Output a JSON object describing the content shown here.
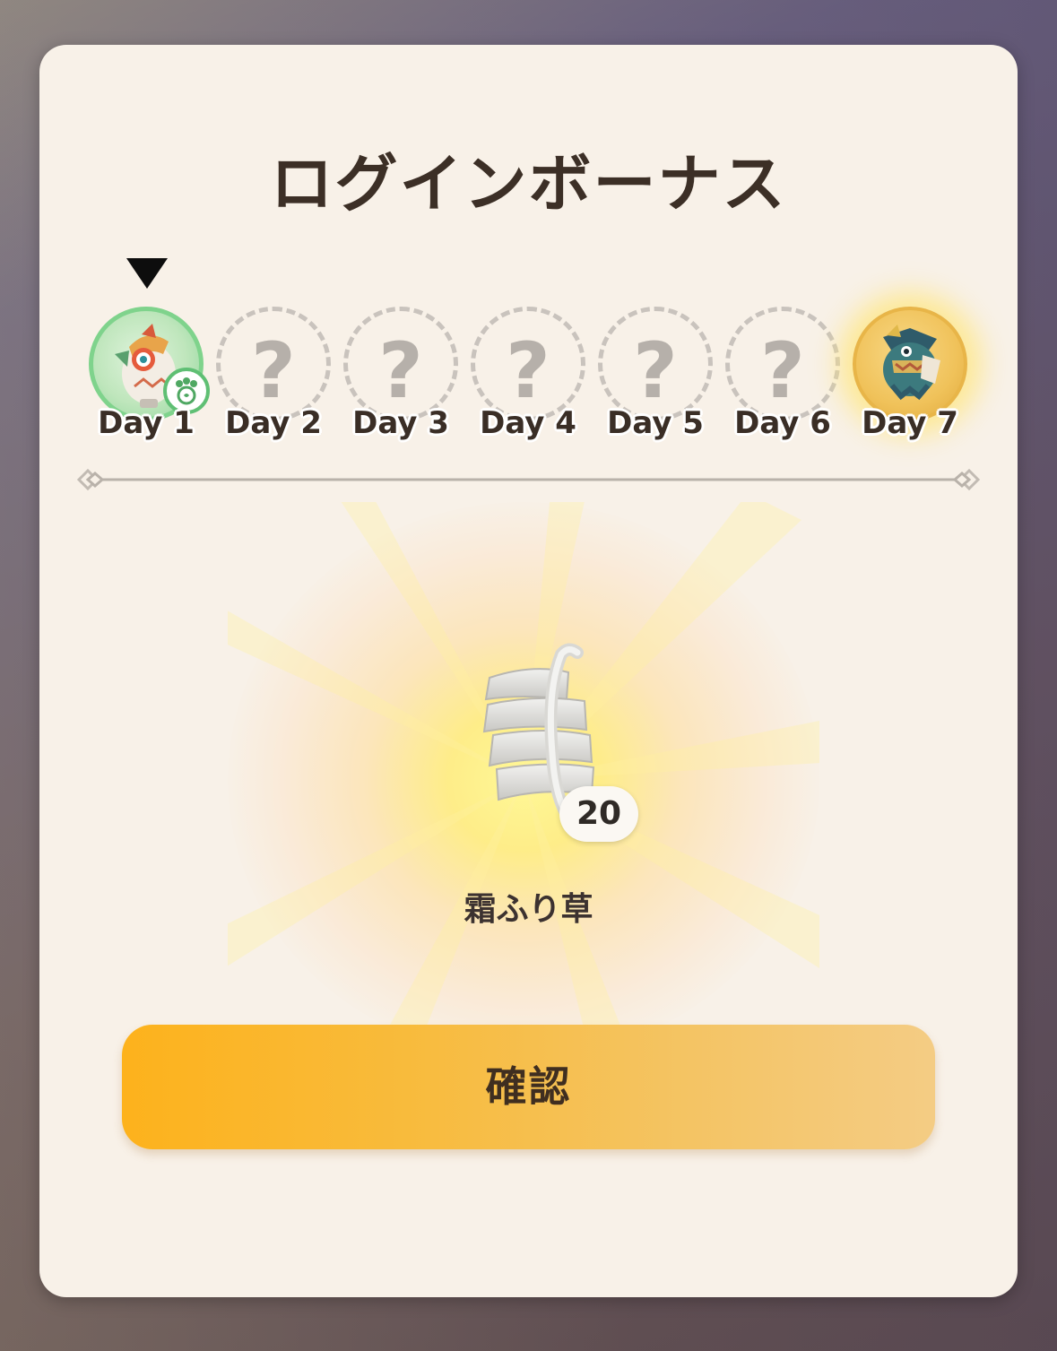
{
  "dialog": {
    "title": "ログインボーナス"
  },
  "days": [
    {
      "label": "Day 1",
      "state": "claimed",
      "icon": "bird-monster-icon"
    },
    {
      "label": "Day 2",
      "state": "unknown",
      "symbol": "?"
    },
    {
      "label": "Day 3",
      "state": "unknown",
      "symbol": "?"
    },
    {
      "label": "Day 4",
      "state": "unknown",
      "symbol": "?"
    },
    {
      "label": "Day 5",
      "state": "unknown",
      "symbol": "?"
    },
    {
      "label": "Day 6",
      "state": "unknown",
      "symbol": "?"
    },
    {
      "label": "Day 7",
      "state": "special",
      "icon": "tribal-monster-icon"
    }
  ],
  "reward": {
    "name": "霜ふり草",
    "quantity": "20",
    "icon": "frost-grass-icon"
  },
  "confirm_label": "確認",
  "colors": {
    "panel": "#f8f1e8",
    "title": "#3c2f26",
    "button_start": "#fdb21c",
    "button_end": "#f4cc84",
    "claimed_green": "#7fd38c",
    "special_gold": "#f0c25a"
  }
}
